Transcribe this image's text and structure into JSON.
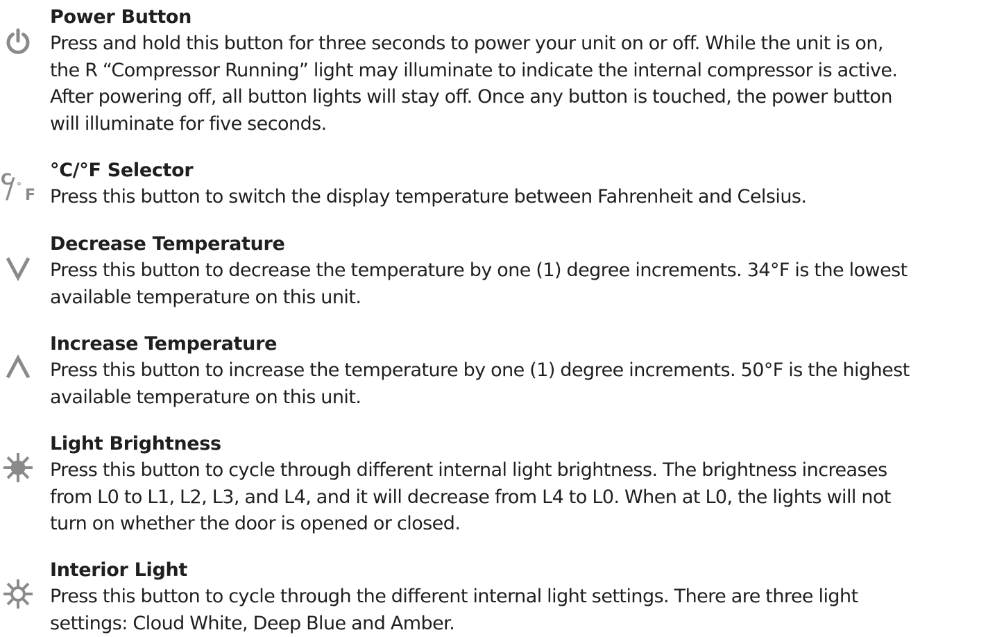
{
  "colors": {
    "text": "#1f1f1f",
    "icon": "#8a8a8a",
    "background": "#ffffff"
  },
  "sections": [
    {
      "icon": "power-icon",
      "title": "Power Button",
      "lines": [
        "Press and hold this button for three seconds to power your unit on or off. While the unit is on,",
        "the R “Compressor Running” light may illuminate to indicate the internal compressor is active.",
        "After powering off, all button lights will stay off. Once any button is touched, the power button",
        "will illuminate for five seconds."
      ]
    },
    {
      "icon": "celsius-fahrenheit-icon",
      "icon_text": {
        "c": "C",
        "slash": "/",
        "deg": "°",
        "f": "F"
      },
      "title": "°C/°F Selector",
      "lines": [
        "Press this button to switch the display temperature between Fahrenheit and Celsius."
      ]
    },
    {
      "icon": "chevron-down-icon",
      "title": "Decrease Temperature",
      "lines": [
        "Press this button to decrease the temperature by one (1) degree increments. 34°F is the lowest",
        "available temperature on this unit."
      ]
    },
    {
      "icon": "chevron-up-icon",
      "title": "Increase Temperature",
      "lines": [
        "Press this button to increase the temperature by one (1) degree increments. 50°F is the highest",
        "available temperature on this unit."
      ]
    },
    {
      "icon": "brightness-icon",
      "title": "Light Brightness",
      "lines": [
        "Press this button to cycle through different internal light brightness. The brightness increases",
        "from L0 to L1, L2, L3, and L4, and it will decrease from L4 to L0. When at L0, the lights will not",
        "turn on whether the door is opened or closed."
      ]
    },
    {
      "icon": "interior-light-icon",
      "title": "Interior Light",
      "lines": [
        "Press this button to cycle through the different internal light settings. There are three light",
        "settings: Cloud White, Deep Blue and Amber."
      ]
    }
  ]
}
